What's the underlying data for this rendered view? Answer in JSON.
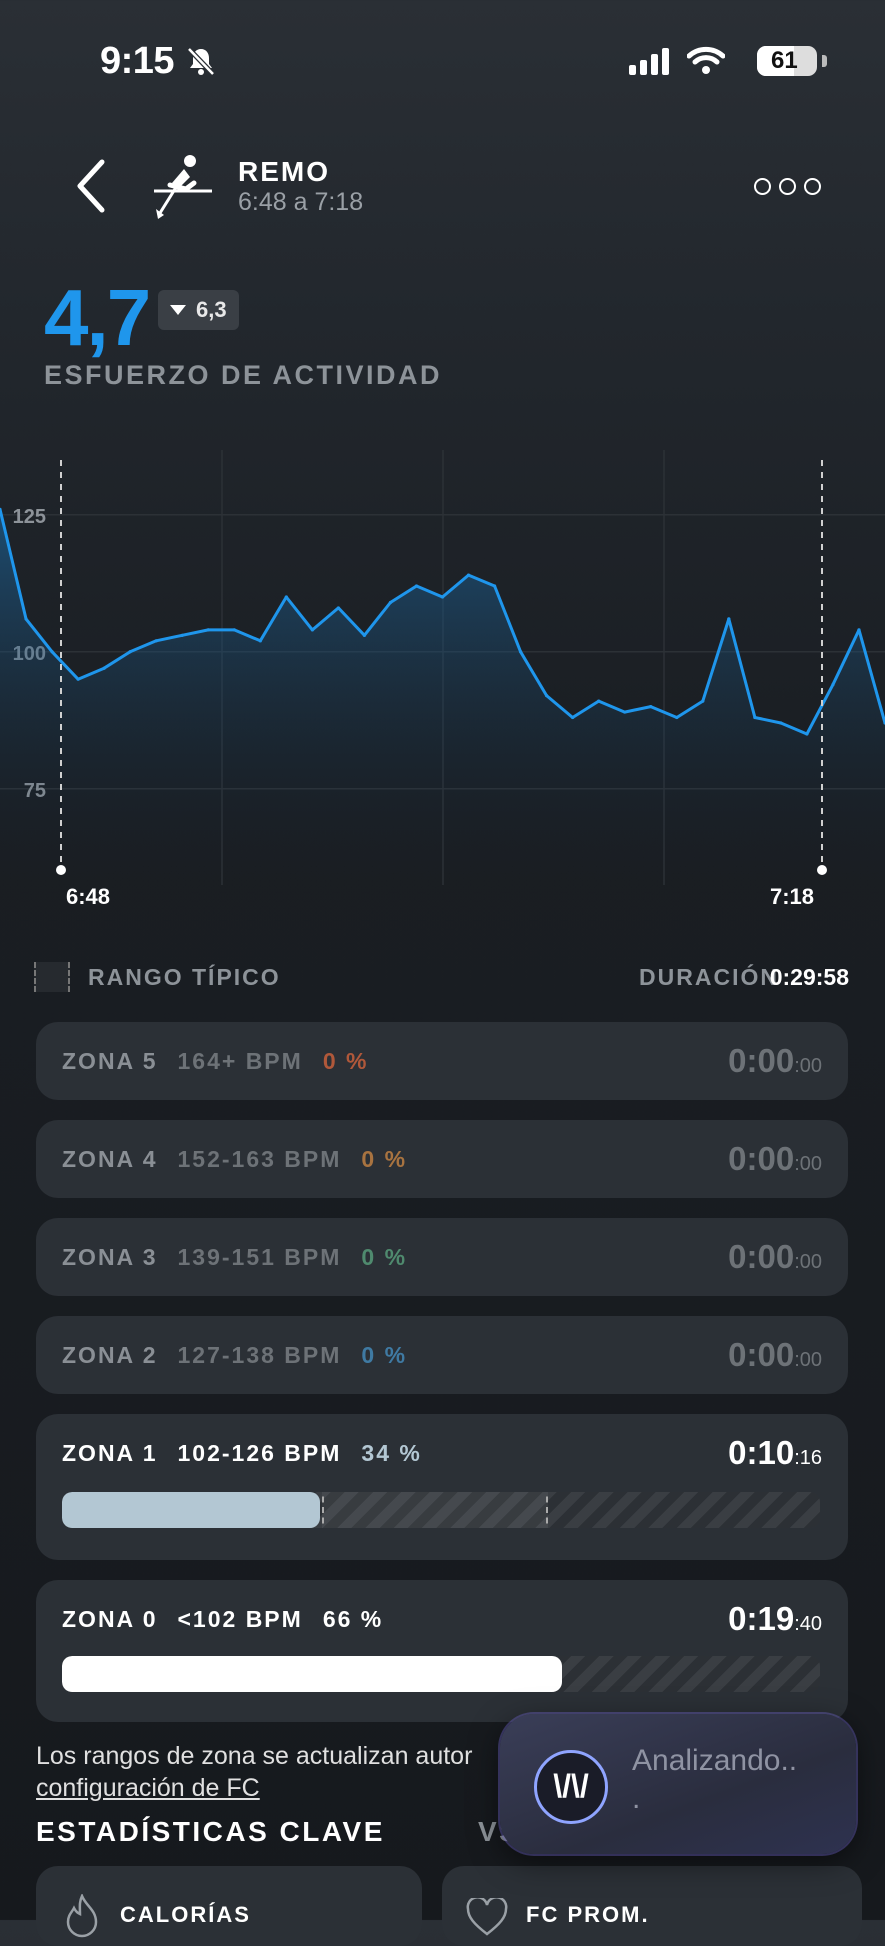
{
  "status_bar": {
    "time": "9:15",
    "battery": "61"
  },
  "header": {
    "title": "REMO",
    "time_range": "6:48 a 7:18"
  },
  "effort": {
    "value": "4,7",
    "delta": "6,3",
    "label": "ESFUERZO DE ACTIVIDAD"
  },
  "chart_data": {
    "type": "area",
    "x_start_label": "6:48",
    "x_end_label": "7:18",
    "y_ticks": [
      "125",
      "100",
      "75"
    ],
    "ylim": [
      62,
      135
    ],
    "x": [
      0,
      1,
      2,
      3,
      4,
      5,
      6,
      7,
      8,
      9,
      10,
      11,
      12,
      13,
      14,
      15,
      16,
      17,
      18,
      19,
      20,
      21,
      22,
      23,
      24,
      25,
      26,
      27,
      28,
      29,
      30,
      31,
      32,
      33,
      34
    ],
    "values": [
      126,
      106,
      100,
      95,
      97,
      100,
      102,
      103,
      104,
      104,
      102,
      110,
      104,
      108,
      103,
      109,
      112,
      110,
      114,
      112,
      100,
      92,
      88,
      91,
      89,
      90,
      88,
      91,
      106,
      88,
      87,
      85,
      94,
      104,
      87
    ]
  },
  "range": {
    "label": "RANGO TÍPICO",
    "duration_label": "DURACIÓN",
    "duration": "0:29:58"
  },
  "zones": [
    {
      "name": "ZONA 5",
      "bpm": "164+ BPM",
      "pct": "0 %",
      "pct_color": "#b0583a",
      "time_main": "0:00",
      "time_sec": ":00"
    },
    {
      "name": "ZONA 4",
      "bpm": "152-163 BPM",
      "pct": "0 %",
      "pct_color": "#a87340",
      "time_main": "0:00",
      "time_sec": ":00"
    },
    {
      "name": "ZONA 3",
      "bpm": "139-151 BPM",
      "pct": "0 %",
      "pct_color": "#4f8a6e",
      "time_main": "0:00",
      "time_sec": ":00"
    },
    {
      "name": "ZONA 2",
      "bpm": "127-138 BPM",
      "pct": "0 %",
      "pct_color": "#3f7aa3",
      "time_main": "0:00",
      "time_sec": ":00"
    },
    {
      "name": "ZONA 1",
      "bpm": "102-126 BPM",
      "pct": "34 %",
      "pct_color": "#b3c7d3",
      "time_main": "0:10",
      "time_sec": ":16",
      "fill_pct": 34
    },
    {
      "name": "ZONA 0",
      "bpm": "<102 BPM",
      "pct": "66 %",
      "pct_color": "#ffffff",
      "time_main": "0:19",
      "time_sec": ":40",
      "fill_pct": 66
    }
  ],
  "footer": {
    "note_line1": "Los rangos de zona se actualizan autor",
    "note_link": "configuración de FC",
    "key_stats": "ESTADÍSTICAS CLAVE",
    "vs": "VS"
  },
  "cards": [
    {
      "label": "CALORÍAS"
    },
    {
      "label": "FC PROM."
    }
  ],
  "toast": {
    "text": "Analizando..",
    "dot": "."
  },
  "colors": {
    "accent": "#1f96ec",
    "zone1_fill": "#b3c7d3",
    "zone0_fill": "#ffffff"
  }
}
